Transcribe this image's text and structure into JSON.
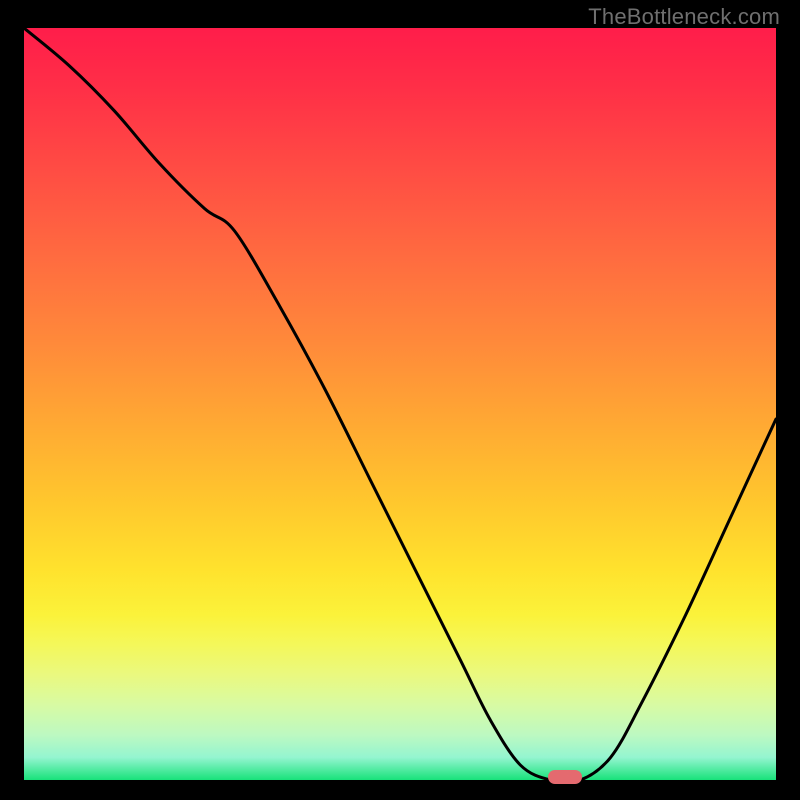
{
  "watermark": "TheBottleneck.com",
  "chart_data": {
    "type": "line",
    "title": "",
    "xlabel": "",
    "ylabel": "",
    "xlim": [
      0,
      100
    ],
    "ylim": [
      0,
      100
    ],
    "x": [
      0,
      6,
      12,
      18,
      24,
      28,
      34,
      40,
      46,
      52,
      58,
      62,
      66,
      70,
      74,
      78,
      82,
      88,
      94,
      100
    ],
    "values": [
      100,
      95,
      89,
      82,
      76,
      73,
      63,
      52,
      40,
      28,
      16,
      8,
      2,
      0,
      0,
      3,
      10,
      22,
      35,
      48
    ],
    "marker": {
      "x": 72,
      "y": 0
    },
    "gradient_stops": [
      {
        "pos": 0,
        "color": "#ff1d4a"
      },
      {
        "pos": 50,
        "color": "#ffaa33"
      },
      {
        "pos": 80,
        "color": "#fbf23a"
      },
      {
        "pos": 100,
        "color": "#18e27a"
      }
    ]
  }
}
